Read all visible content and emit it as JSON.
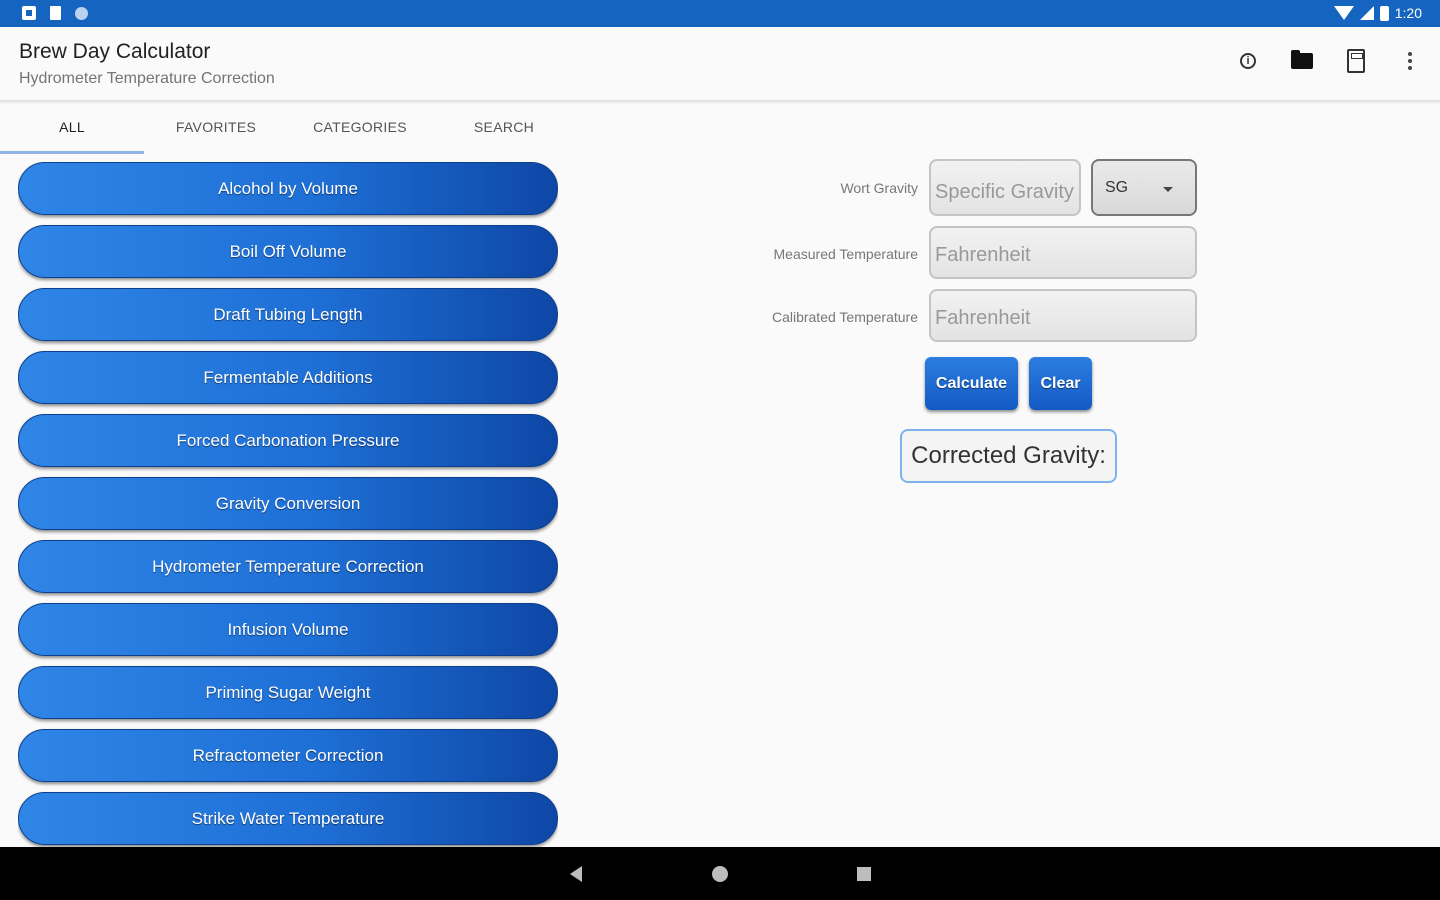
{
  "status_bar": {
    "time": "1:20"
  },
  "app_bar": {
    "title": "Brew Day Calculator",
    "subtitle": "Hydrometer Temperature Correction",
    "actions": [
      "info-icon",
      "folder-icon",
      "calculator-icon",
      "more-vert-icon"
    ]
  },
  "tabs": [
    {
      "label": "ALL",
      "active": true
    },
    {
      "label": "FAVORITES",
      "active": false
    },
    {
      "label": "CATEGORIES",
      "active": false
    },
    {
      "label": "SEARCH",
      "active": false
    }
  ],
  "calculators": [
    "Alcohol by Volume",
    "Boil Off Volume",
    "Draft Tubing Length",
    "Fermentable Additions",
    "Forced Carbonation Pressure",
    "Gravity Conversion",
    "Hydrometer Temperature Correction",
    "Infusion Volume",
    "Priming Sugar Weight",
    "Refractometer Correction",
    "Strike Water Temperature"
  ],
  "form": {
    "wort_gravity": {
      "label": "Wort Gravity",
      "placeholder": "Specific Gravity",
      "unit": "SG"
    },
    "measured_temperature": {
      "label": "Measured Temperature",
      "placeholder": "Fahrenheit"
    },
    "calibrated_temperature": {
      "label": "Calibrated Temperature",
      "placeholder": "Fahrenheit"
    },
    "calculate_label": "Calculate",
    "clear_label": "Clear",
    "result_label": "Corrected Gravity:"
  },
  "colors": {
    "status_bar": "#1565c0",
    "button_primary": "#1e6fd6",
    "button_dark": "#0e47a6",
    "result_border": "#7cb3ee"
  }
}
